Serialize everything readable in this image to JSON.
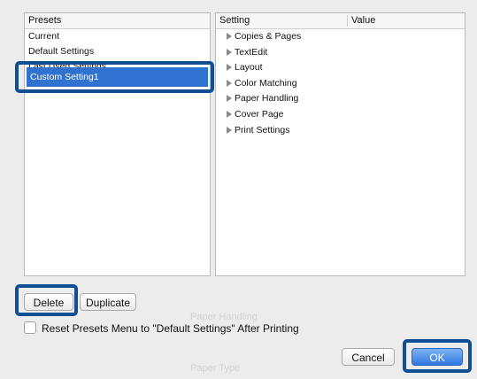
{
  "presets_panel": {
    "header": "Presets",
    "items": [
      {
        "label": "Current"
      },
      {
        "label": "Default Settings"
      },
      {
        "label": "Last Used Settings"
      },
      {
        "label": "Custom Setting1"
      }
    ]
  },
  "settings_panel": {
    "columns": {
      "setting": "Setting",
      "value": "Value"
    },
    "items": [
      {
        "label": "Copies & Pages"
      },
      {
        "label": "TextEdit"
      },
      {
        "label": "Layout"
      },
      {
        "label": "Color Matching"
      },
      {
        "label": "Paper Handling"
      },
      {
        "label": "Cover Page"
      },
      {
        "label": "Print Settings"
      }
    ]
  },
  "buttons": {
    "delete": "Delete",
    "duplicate": "Duplicate",
    "cancel": "Cancel",
    "ok": "OK"
  },
  "reset_checkbox": {
    "label": "Reset Presets Menu to \"Default Settings\" After Printing",
    "checked": false
  },
  "background_text": {
    "paper_handling": "Paper Handling",
    "paper_type": "Paper Type"
  },
  "colors": {
    "selection": "#2f72d0",
    "highlight": "#0e4f93",
    "primary_button": "#2f78e0"
  }
}
